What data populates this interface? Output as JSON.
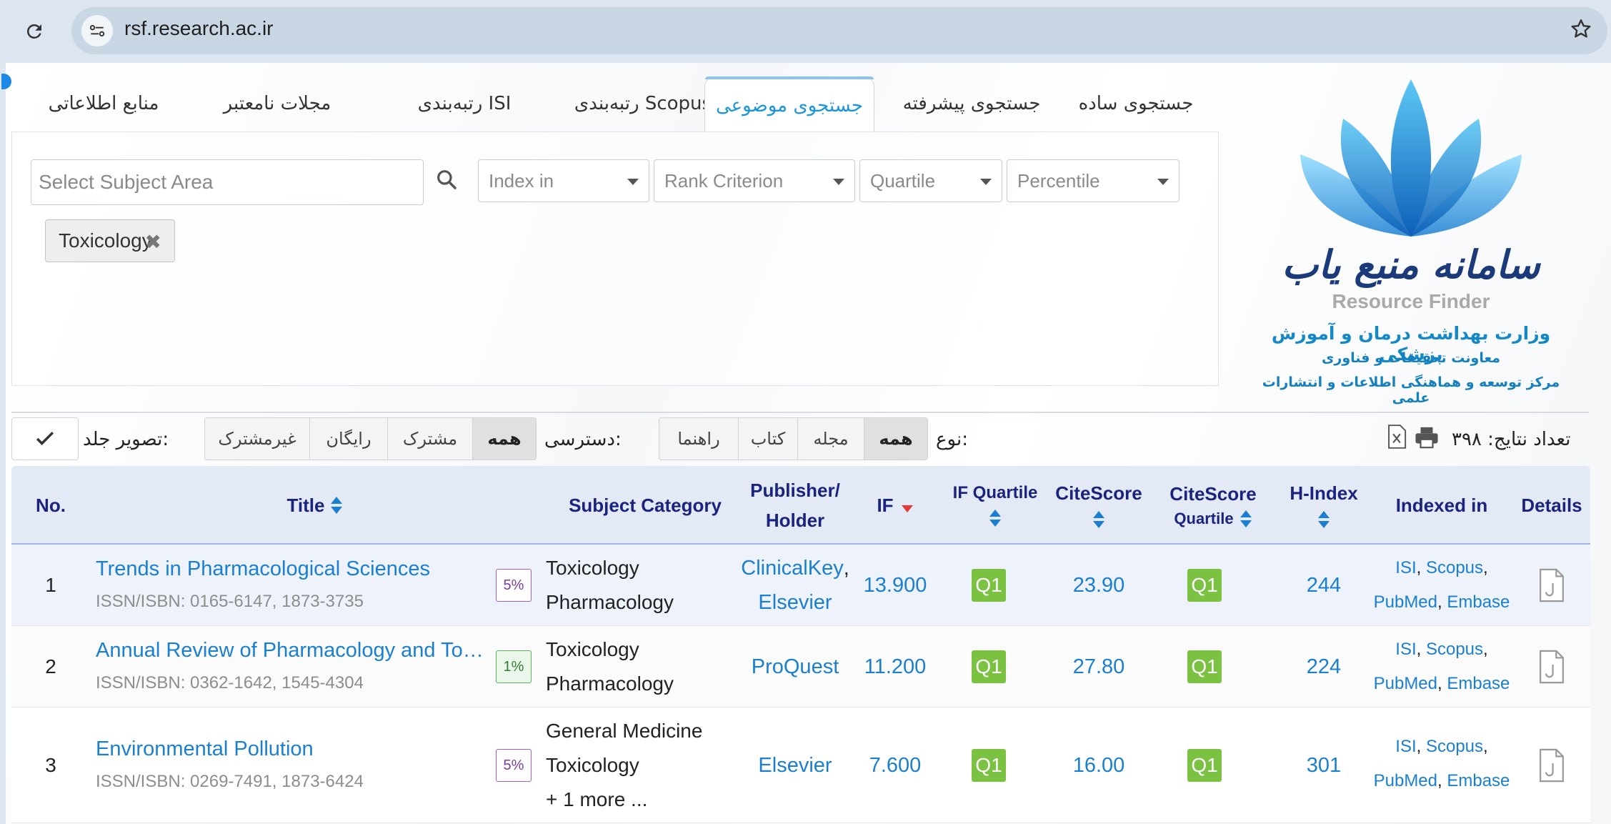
{
  "browser": {
    "url": "rsf.research.ac.ir"
  },
  "tabs": [
    {
      "label": "منابع اطلاعاتی"
    },
    {
      "label": "مجلات نامعتبر"
    },
    {
      "label": "رتبه‌بندی ISI"
    },
    {
      "label": "رتبه‌بندی Scopus"
    },
    {
      "label": "جستجوی موضوعی",
      "active": true
    },
    {
      "label": "جستجوی پیشرفته"
    },
    {
      "label": "جستجوی ساده"
    }
  ],
  "filters": {
    "subject_placeholder": "Select Subject Area",
    "index_in": "Index in",
    "rank_criterion": "Rank Criterion",
    "quartile": "Quartile",
    "percentile": "Percentile",
    "selected_tag": "Toxicology"
  },
  "logo": {
    "title": "سامانه منبع یاب",
    "subtitle": "Resource Finder",
    "line1": "وزارت بهداشت درمان و آموزش پزشکی",
    "line2": "معاونت تحقیقات و فناوری",
    "line3": "مرکز توسعه و هماهنگی اطلاعات و انتشارات علمی"
  },
  "toolbar": {
    "results_label": "تعداد نتایج: ۳۹۸",
    "type_label": "نوع:",
    "type_options": [
      "همه",
      "مجله",
      "کتاب",
      "راهنما"
    ],
    "access_label": "دسترسی:",
    "access_options": [
      "همه",
      "مشترک",
      "رایگان",
      "غیرمشترک"
    ],
    "cover_label": "تصویر جلد:"
  },
  "table": {
    "headers": {
      "no": "No.",
      "title": "Title",
      "subject": "Subject Category",
      "publisher_1": "Publisher/",
      "publisher_2": "Holder",
      "if": "IF",
      "if_quartile": "IF Quartile",
      "citescore": "CiteScore",
      "cs_quartile_1": "CiteScore",
      "cs_quartile_2": "Quartile",
      "hindex": "H-Index",
      "indexed": "Indexed in",
      "details": "Details"
    },
    "rows": [
      {
        "no": "1",
        "title": "Trends in Pharmacological Sciences",
        "issn": "ISSN/ISBN: 0165-6147, 1873-3735",
        "pct": "5%",
        "subjects": [
          "Toxicology",
          "Pharmacology"
        ],
        "publisher_a": "ClinicalKey",
        "publisher_sep": ",",
        "publisher_b": "Elsevier",
        "if": "13.900",
        "if_q": "Q1",
        "citescore": "23.90",
        "cs_q": "Q1",
        "hindex": "244",
        "idx_a": "ISI",
        "idx_b": "Scopus",
        "idx_c": "PubMed",
        "idx_d": "Embase"
      },
      {
        "no": "2",
        "title": "Annual Review of Pharmacology and To…",
        "issn": "ISSN/ISBN: 0362-1642, 1545-4304",
        "pct": "1%",
        "subjects": [
          "Toxicology",
          "Pharmacology"
        ],
        "publisher_a": "ProQuest",
        "if": "11.200",
        "if_q": "Q1",
        "citescore": "27.80",
        "cs_q": "Q1",
        "hindex": "224",
        "idx_a": "ISI",
        "idx_b": "Scopus",
        "idx_c": "PubMed",
        "idx_d": "Embase"
      },
      {
        "no": "3",
        "title": "Environmental Pollution",
        "issn": "ISSN/ISBN: 0269-7491, 1873-6424",
        "pct": "5%",
        "subjects": [
          "General Medicine",
          "Toxicology",
          "+ 1 more ..."
        ],
        "publisher_a": "Elsevier",
        "if": "7.600",
        "if_q": "Q1",
        "citescore": "16.00",
        "cs_q": "Q1",
        "hindex": "301",
        "idx_a": "ISI",
        "idx_b": "Scopus",
        "idx_c": "PubMed",
        "idx_d": "Embase"
      }
    ]
  },
  "colors": {
    "link": "#1a7fd1",
    "header_text": "#1a237e",
    "quartile_bg": "#7cc242",
    "active_tab": "#1a95d8"
  }
}
